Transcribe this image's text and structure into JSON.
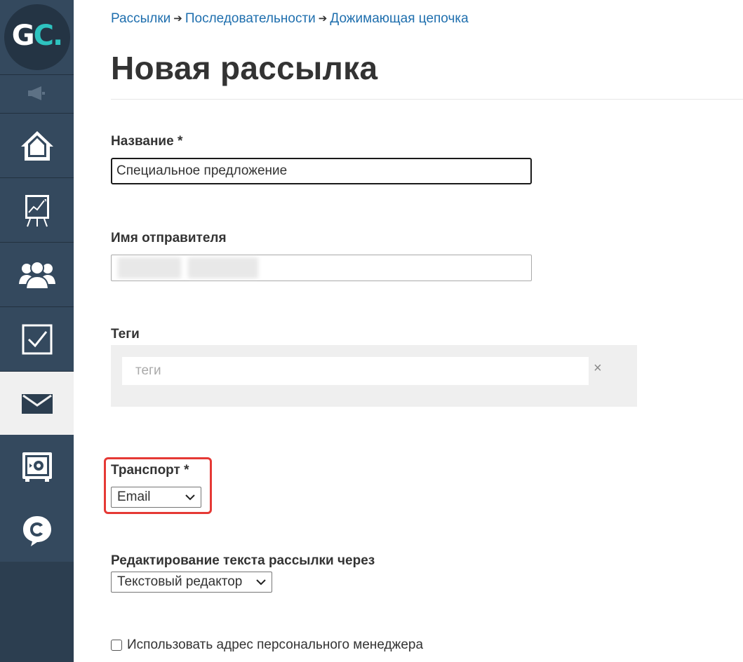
{
  "sidebar": {
    "logo": {
      "text_main": "G",
      "text_accent": "C."
    },
    "items": [
      {
        "icon": "speaker-icon",
        "active": false
      },
      {
        "icon": "home-icon",
        "active": false
      },
      {
        "icon": "chart-board-icon",
        "active": false
      },
      {
        "icon": "users-icon",
        "active": false
      },
      {
        "icon": "checkbox-icon",
        "active": false
      },
      {
        "icon": "mail-icon",
        "active": true
      },
      {
        "icon": "safe-icon",
        "active": false
      },
      {
        "icon": "chat-icon",
        "active": false
      }
    ],
    "colors": {
      "bg": "#34495e",
      "accent": "#2ec3c0",
      "active_bg": "#f0f0f0"
    }
  },
  "breadcrumb": {
    "items": [
      "Рассылки",
      "Последовательности",
      "Дожимающая цепочка"
    ],
    "separator": "➔"
  },
  "page": {
    "title": "Новая рассылка"
  },
  "form": {
    "name": {
      "label": "Название *",
      "value": "Специальное предложение"
    },
    "sender": {
      "label": "Имя отправителя",
      "value": ""
    },
    "tags": {
      "label": "Теги",
      "placeholder": "теги",
      "clear": "×"
    },
    "transport": {
      "label": "Транспорт *",
      "selected": "Email"
    },
    "editor": {
      "label": "Редактирование текста рассылки через",
      "selected": "Текстовый редактор"
    },
    "manager_checkbox": {
      "label": "Использовать адрес персонального менеджера",
      "checked": false
    }
  },
  "highlight_color": "#e53935"
}
